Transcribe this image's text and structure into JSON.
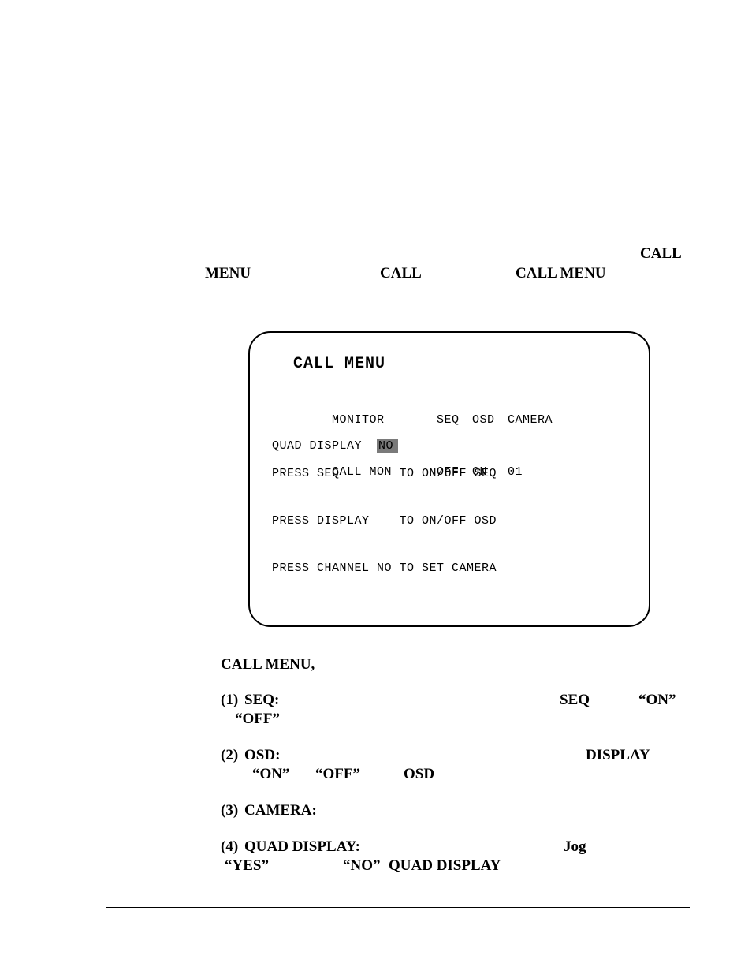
{
  "topline": {
    "menu": "MENU",
    "call": "CALL",
    "call_menu": "CALL MENU",
    "call2": "CALL"
  },
  "monitor": {
    "title": "CALL MENU",
    "headers": {
      "c1": "MONITOR",
      "c2": "SEQ",
      "c3": "OSD",
      "c4": "CAMERA"
    },
    "row": {
      "c1": "CALL MON",
      "c2": "OFF",
      "c3": "ON",
      "c4": "01"
    },
    "quad": {
      "label": "QUAD DISPLAY",
      "value": "NO"
    },
    "help": {
      "l1": "PRESS SEQ        TO ON/OFF SEQ",
      "l2": "PRESS DISPLAY    TO ON/OFF OSD",
      "l3": "PRESS CHANNEL NO TO SET CAMERA"
    }
  },
  "body": {
    "call_menu_comma": "CALL MENU,",
    "s1": {
      "num": "(1)",
      "seq": "SEQ:",
      "seq2": "SEQ",
      "on": "“ON”",
      "off": "“OFF”"
    },
    "s2": {
      "num": "(2)",
      "osd": "OSD:",
      "display": "DISPLAY",
      "on": "“ON”",
      "off": "“OFF”",
      "osd2": "OSD"
    },
    "s3": {
      "num": "(3)",
      "camera": "CAMERA:"
    },
    "s4": {
      "num": "(4)",
      "qd": "QUAD DISPLAY:",
      "jog": "Jog",
      "yes": "“YES”",
      "no": "“NO”",
      "qd2": "QUAD DISPLAY"
    }
  }
}
